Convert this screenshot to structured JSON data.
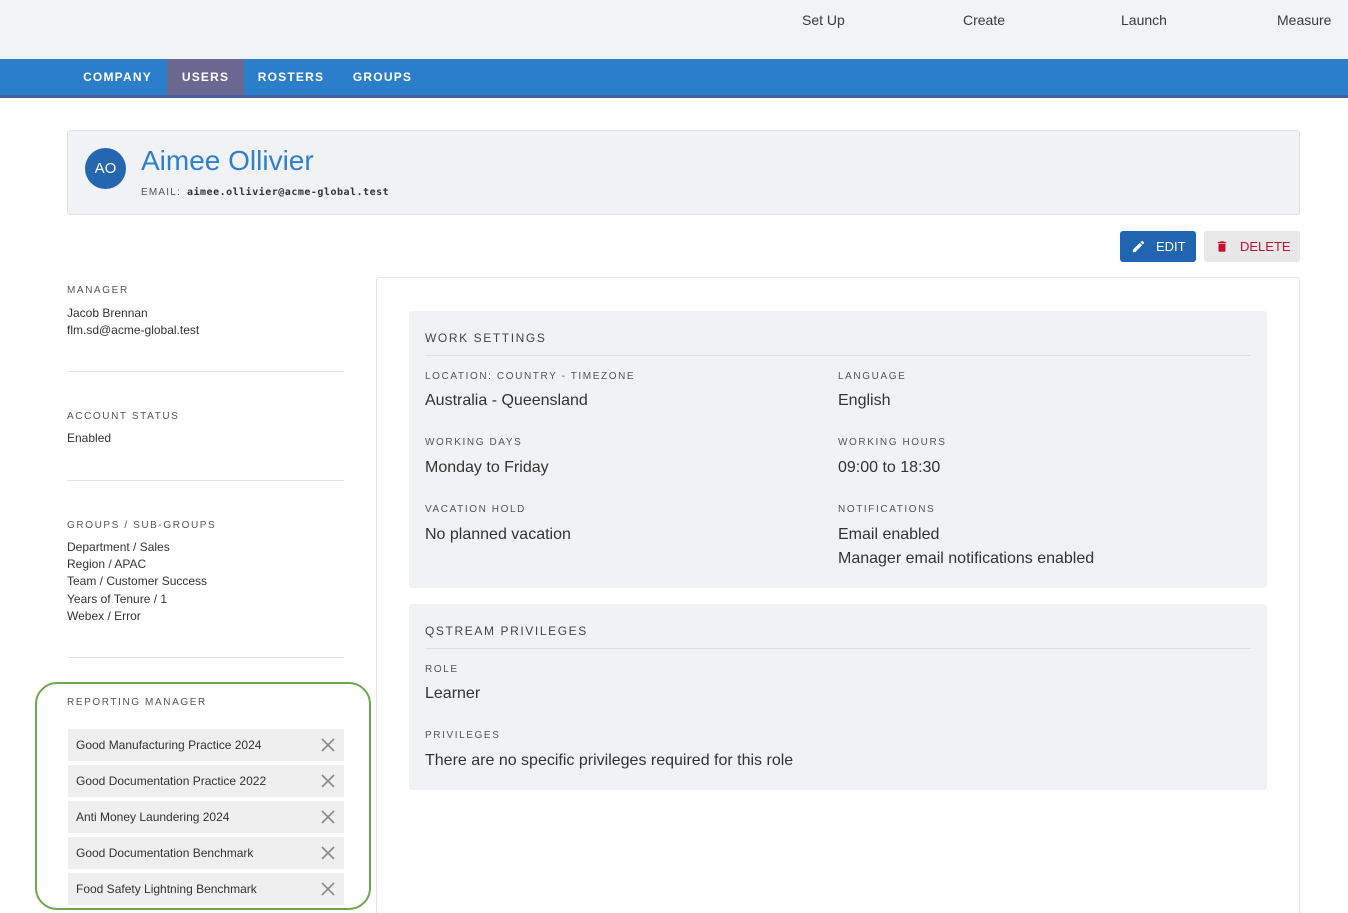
{
  "top_nav": [
    "Set Up",
    "Create",
    "Launch",
    "Measure"
  ],
  "tabs": [
    "COMPANY",
    "USERS",
    "ROSTERS",
    "GROUPS"
  ],
  "active_tab": "USERS",
  "profile": {
    "initials": "AO",
    "name": "Aimee Ollivier",
    "email_label": "EMAIL:",
    "email": "aimee.ollivier@acme-global.test"
  },
  "actions": {
    "edit": "EDIT",
    "delete": "DELETE"
  },
  "sidebar": {
    "manager_label": "MANAGER",
    "manager_name": "Jacob Brennan",
    "manager_email": "flm.sd@acme-global.test",
    "account_status_label": "ACCOUNT STATUS",
    "account_status": "Enabled",
    "groups_label": "GROUPS / SUB-GROUPS",
    "groups": [
      "Department / Sales",
      "Region / APAC",
      "Team / Customer Success",
      "Years of Tenure / 1",
      "Webex / Error"
    ],
    "reporting_manager_label": "REPORTING MANAGER",
    "reporting_manager_items": [
      "Good Manufacturing Practice 2024",
      "Good Documentation Practice 2022",
      "Anti Money Laundering 2024",
      "Good Documentation Benchmark",
      "Food Safety Lightning Benchmark"
    ]
  },
  "work_settings": {
    "title": "WORK SETTINGS",
    "location_label": "LOCATION: COUNTRY - TIMEZONE",
    "location": "Australia - Queensland",
    "language_label": "LANGUAGE",
    "language": "English",
    "working_days_label": "WORKING DAYS",
    "working_days": "Monday to Friday",
    "working_hours_label": "WORKING HOURS",
    "working_hours": "09:00 to 18:30",
    "vacation_label": "VACATION HOLD",
    "vacation": "No planned vacation",
    "notifications_label": "NOTIFICATIONS",
    "notifications": [
      "Email enabled",
      "Manager email notifications enabled"
    ]
  },
  "privileges": {
    "title": "QSTREAM PRIVILEGES",
    "role_label": "ROLE",
    "role": "Learner",
    "privileges_label": "PRIVILEGES",
    "privileges": "There are no specific privileges required for this role"
  },
  "colors": {
    "tab_bar": "#2b7fca",
    "active_tab": "#6a6791",
    "accent_blue": "#2f7fcf",
    "delete_red": "#c8102e",
    "highlight_green": "#6aa84f"
  }
}
